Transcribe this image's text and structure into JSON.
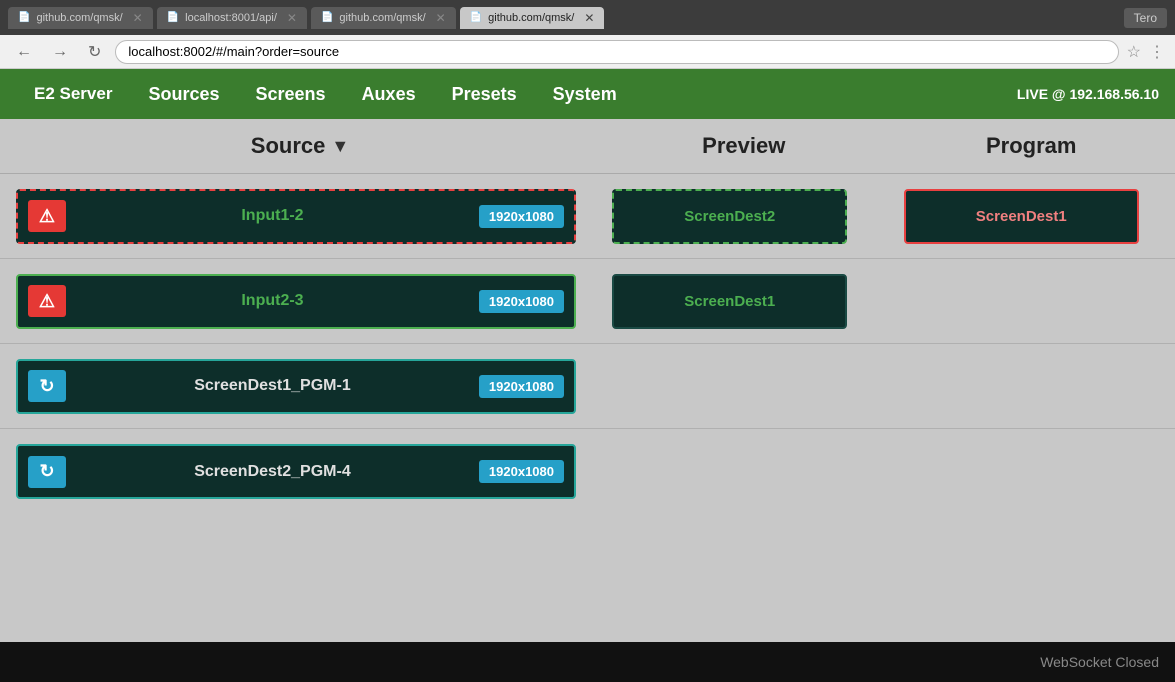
{
  "browser": {
    "tabs": [
      {
        "id": "tab1",
        "label": "github.com/qmsk/",
        "active": false,
        "icon": "📄"
      },
      {
        "id": "tab2",
        "label": "localhost:8001/api/",
        "active": false,
        "icon": "📄"
      },
      {
        "id": "tab3",
        "label": "github.com/qmsk/",
        "active": false,
        "icon": "📄"
      },
      {
        "id": "tab4",
        "label": "github.com/qmsk/",
        "active": true,
        "icon": "📄"
      }
    ],
    "user": "Tero",
    "address": "localhost:8002/#/main?order=source"
  },
  "nav": {
    "brand": "E2 Server",
    "items": [
      "Sources",
      "Screens",
      "Auxes",
      "Presets",
      "System"
    ],
    "live": "LIVE @ 192.168.56.10"
  },
  "columns": {
    "source": "Source",
    "preview": "Preview",
    "program": "Program"
  },
  "rows": [
    {
      "source": {
        "label": "Input1-2",
        "resolution": "1920x1080",
        "icon_type": "warning",
        "border": "red-dashed",
        "label_color": "green"
      },
      "preview": {
        "label": "ScreenDest2",
        "border": "green-dashed",
        "label_color": "green"
      },
      "program": {
        "label": "ScreenDest1",
        "border": "red-solid",
        "label_color": "salmon"
      }
    },
    {
      "source": {
        "label": "Input2-3",
        "resolution": "1920x1080",
        "icon_type": "warning",
        "border": "green-solid",
        "label_color": "green"
      },
      "preview": {
        "label": "ScreenDest1",
        "border": "dark-solid",
        "label_color": "green"
      },
      "program": null
    },
    {
      "source": {
        "label": "ScreenDest1_PGM-1",
        "resolution": "1920x1080",
        "icon_type": "camera",
        "border": "teal-solid",
        "label_color": "white"
      },
      "preview": null,
      "program": null
    },
    {
      "source": {
        "label": "ScreenDest2_PGM-4",
        "resolution": "1920x1080",
        "icon_type": "camera",
        "border": "teal-solid",
        "label_color": "white"
      },
      "preview": null,
      "program": null
    }
  ],
  "status": {
    "text": "WebSocket Closed"
  },
  "icons": {
    "warning": "⚠",
    "camera": "↻",
    "sort_down": "▾",
    "back": "←",
    "forward": "→",
    "reload": "↺",
    "star": "☆",
    "menu": "⋮"
  }
}
